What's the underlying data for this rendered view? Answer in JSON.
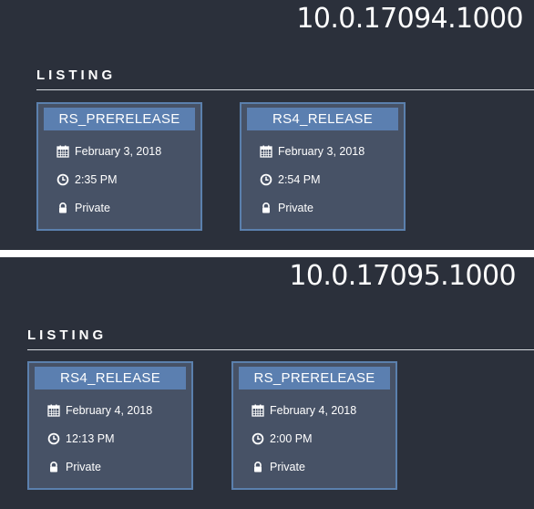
{
  "panels": [
    {
      "version": "10.0.17094.1000",
      "listing_label": "LISTING",
      "cards": [
        {
          "title": "RS_PRERELEASE",
          "date": "February 3, 2018",
          "time": "2:35 PM",
          "visibility": "Private"
        },
        {
          "title": "RS4_RELEASE",
          "date": "February 3, 2018",
          "time": "2:54 PM",
          "visibility": "Private"
        }
      ]
    },
    {
      "version": "10.0.17095.1000",
      "listing_label": "LISTING",
      "cards": [
        {
          "title": "RS4_RELEASE",
          "date": "February 4, 2018",
          "time": "12:13 PM",
          "visibility": "Private"
        },
        {
          "title": "RS_PRERELEASE",
          "date": "February 4, 2018",
          "time": "2:00 PM",
          "visibility": "Private"
        }
      ]
    }
  ],
  "icons": {
    "date": "calendar-icon",
    "time": "clock-icon",
    "visibility": "lock-icon"
  },
  "colors": {
    "background": "#2b303b",
    "card": "#475266",
    "card_title": "#5b7fb0",
    "card_border": "#5b80ad",
    "text": "#ffffff"
  }
}
